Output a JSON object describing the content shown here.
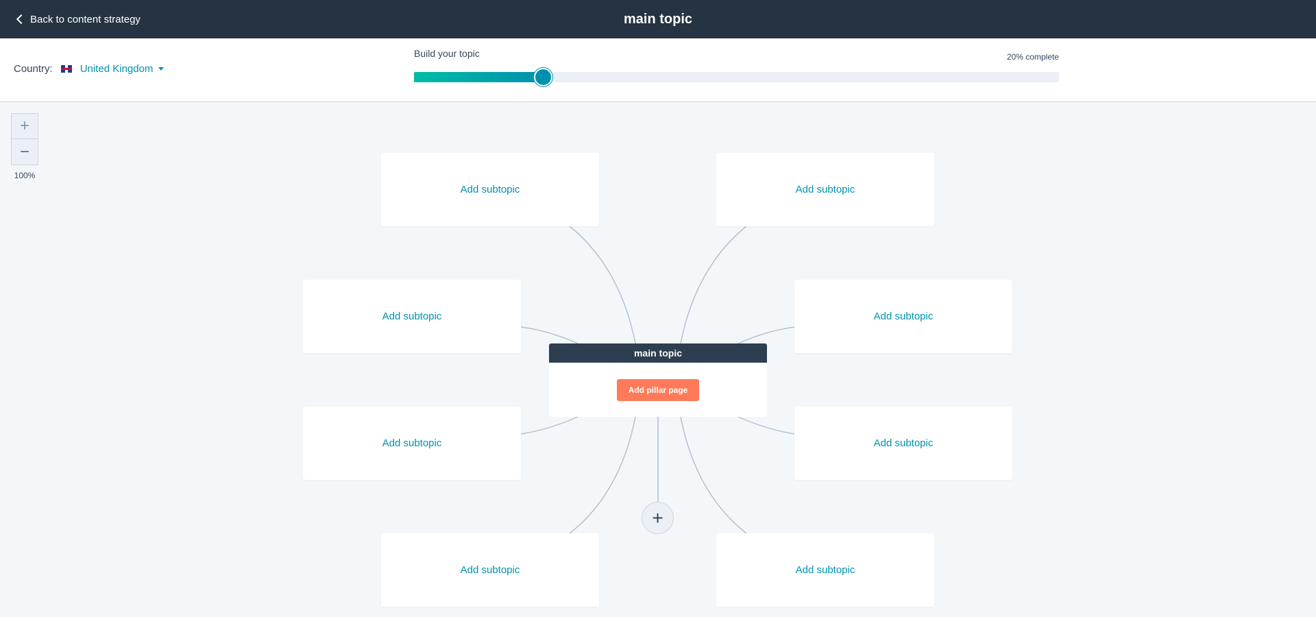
{
  "header": {
    "back_label": "Back to content strategy",
    "title": "main topic"
  },
  "country": {
    "label": "Country:",
    "selected": "United Kingdom",
    "flag_icon": "uk-flag-icon"
  },
  "progress": {
    "label": "Build your topic",
    "status": "20% complete",
    "percent": 20
  },
  "zoom": {
    "plus": "+",
    "minus": "−",
    "level": "100%"
  },
  "main_topic": {
    "title": "main topic",
    "button_label": "Add pillar page"
  },
  "subtopics": [
    {
      "label": "Add subtopic"
    },
    {
      "label": "Add subtopic"
    },
    {
      "label": "Add subtopic"
    },
    {
      "label": "Add subtopic"
    },
    {
      "label": "Add subtopic"
    },
    {
      "label": "Add subtopic"
    },
    {
      "label": "Add subtopic"
    },
    {
      "label": "Add subtopic"
    }
  ],
  "add_button": "+",
  "colors": {
    "header_bg": "#253342",
    "accent": "#0091ae",
    "progress_start": "#00bda5",
    "pillar_button": "#ff7a59",
    "canvas_bg": "#f4f7f9",
    "connector": "#b0c1d4"
  }
}
